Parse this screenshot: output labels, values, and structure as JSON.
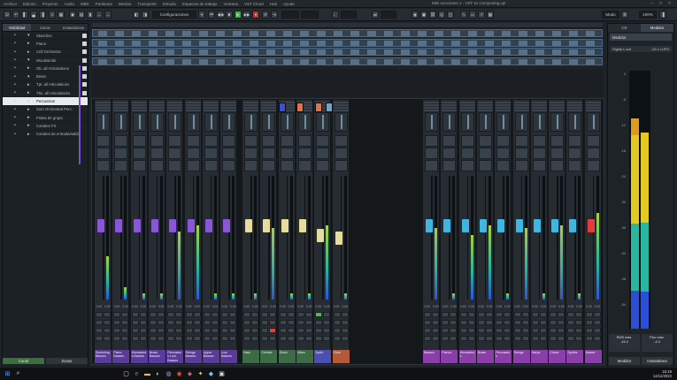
{
  "menu": [
    "Archivo",
    "Edición",
    "Proyecto",
    "Audio",
    "MIDI",
    "Partituras",
    "Medios",
    "Transporte",
    "Estudio",
    "Espacios de trabajo",
    "Ventana",
    "VST Cloud",
    "Hub",
    "Ayuda"
  ],
  "window_title": "Mini Lecciones 1 - VST 11 Composing.cpr",
  "toolbar": {
    "config_label": "Configuraciones",
    "mode_label": "Modo",
    "zoom_label": "100%"
  },
  "left_tabs": [
    "Visibilidad",
    "Zonas",
    "Instantáneas"
  ],
  "tracks": [
    {
      "name": "Sketches",
      "expanded": true
    },
    {
      "name": "Piano",
      "expanded": false
    },
    {
      "name": "Cell Orchestra",
      "expanded": false
    },
    {
      "name": "Woodwinds",
      "expanded": true
    },
    {
      "name": "Ob. all Articulations",
      "expanded": false
    },
    {
      "name": "Brass",
      "expanded": true
    },
    {
      "name": "Tpt. all Articulations",
      "expanded": false
    },
    {
      "name": "Tbn. all Articulations",
      "expanded": false
    },
    {
      "name": "Percussion",
      "expanded": true
    },
    {
      "name": "Sum Orchestral Perc.",
      "expanded": false
    },
    {
      "name": "Pistas de grupo",
      "expanded": false
    },
    {
      "name": "Canales FX",
      "expanded": false
    },
    {
      "name": "Canales de entrada/salida",
      "expanded": false
    }
  ],
  "selected_track_index": 8,
  "left_footer": [
    "Canal",
    "Zonas"
  ],
  "strips_group1": [
    {
      "name": "Sketching Basses",
      "fader": 0.6,
      "level": 0.35,
      "color": "#8a56d8",
      "label_bg": "#5b3b9a"
    },
    {
      "name": "Piano Basses",
      "fader": 0.6,
      "level": 0.1,
      "color": "#8a56d8",
      "label_bg": "#5b3b9a"
    },
    {
      "name": "Woodwinds Basses",
      "fader": 0.6,
      "level": 0.05,
      "color": "#8a56d8",
      "label_bg": "#5b3b9a"
    },
    {
      "name": "Brass Basses",
      "fader": 0.6,
      "level": 0.05,
      "color": "#8a56d8",
      "label_bg": "#5b3b9a"
    },
    {
      "name": "Percussion Low Basses",
      "fader": 0.6,
      "level": 0.55,
      "color": "#8a56d8",
      "label_bg": "#5b3b9a"
    },
    {
      "name": "Strings Basses",
      "fader": 0.6,
      "level": 0.6,
      "color": "#8a56d8",
      "label_bg": "#5b3b9a"
    },
    {
      "name": "Upper Basses",
      "fader": 0.6,
      "level": 0.05,
      "color": "#8a56d8",
      "label_bg": "#5b3b9a"
    },
    {
      "name": "Low Basses",
      "fader": 0.6,
      "level": 0.05,
      "color": "#8a56d8",
      "label_bg": "#5b3b9a"
    }
  ],
  "strips_group2": [
    {
      "name": "Harp",
      "fader": 0.6,
      "level": 0.05,
      "color": "#e6dca0",
      "label_bg": "#3d6b45"
    },
    {
      "name": "Celeste",
      "fader": 0.6,
      "level": 0.58,
      "color": "#e6dca0",
      "label_bg": "#3d6b45"
    },
    {
      "name": "Glock",
      "fader": 0.6,
      "level": 0.05,
      "color": "#e6dca0",
      "label_bg": "#3d6b45"
    },
    {
      "name": "Vibes",
      "fader": 0.6,
      "level": 0.05,
      "color": "#e6dca0",
      "label_bg": "#3d6b45"
    },
    {
      "name": "Synth",
      "fader": 0.52,
      "level": 0.6,
      "color": "#e6dca0",
      "label_bg": "#4b4fb0"
    },
    {
      "name": "Choir",
      "fader": 0.5,
      "level": 0.05,
      "color": "#e6dca0",
      "label_bg": "#b45a3a"
    },
    {
      "name": "Solo",
      "fader": 0.55,
      "level": 0.05,
      "color": "#e6dca0",
      "label_bg": "#3d6b45"
    },
    {
      "name": "FX",
      "fader": 0.6,
      "level": 0.6,
      "color": "#e6dca0",
      "label_bg": "#3d6b45"
    }
  ],
  "strips_group3": [
    {
      "name": "Basses",
      "fader": 0.6,
      "level": 0.58,
      "color": "#3fb6e0",
      "label_bg": "#8a3fa8"
    },
    {
      "name": "Pianos",
      "fader": 0.6,
      "level": 0.05,
      "color": "#3fb6e0",
      "label_bg": "#8a3fa8"
    },
    {
      "name": "Woodwinds",
      "fader": 0.6,
      "level": 0.52,
      "color": "#3fb6e0",
      "label_bg": "#8a3fa8"
    },
    {
      "name": "Brass",
      "fader": 0.6,
      "level": 0.6,
      "color": "#3fb6e0",
      "label_bg": "#8a3fa8"
    },
    {
      "name": "Percussion",
      "fader": 0.6,
      "level": 0.05,
      "color": "#3fb6e0",
      "label_bg": "#8a3fa8"
    },
    {
      "name": "Strings",
      "fader": 0.6,
      "level": 0.58,
      "color": "#3fb6e0",
      "label_bg": "#8a3fa8"
    },
    {
      "name": "Harps",
      "fader": 0.6,
      "level": 0.05,
      "color": "#3fb6e0",
      "label_bg": "#8a3fa8"
    },
    {
      "name": "Choirs",
      "fader": 0.6,
      "level": 0.6,
      "color": "#3fb6e0",
      "label_bg": "#8a3fa8"
    },
    {
      "name": "Synths",
      "fader": 0.6,
      "level": 0.05,
      "color": "#3fb6e0",
      "label_bg": "#8a3fa8"
    },
    {
      "name": "Master",
      "fader": 0.6,
      "level": 0.7,
      "color": "#e23c3c",
      "label_bg": "#8a3fa8"
    }
  ],
  "fader_value": "0.00",
  "right_tabs": [
    "CR",
    "Medidor"
  ],
  "right_panel": {
    "header": "Medidor",
    "sub_label": "Digital Loud",
    "sub_value": "-23.0 LUFS",
    "scale": [
      "0",
      "-6",
      "-12",
      "-18",
      "-24",
      "-30",
      "-36",
      "-42",
      "-48",
      "-54"
    ]
  },
  "loudness_bottom": [
    {
      "label": "RMS máx.",
      "value": "-15.2"
    },
    {
      "label": "Pico máx.",
      "value": "-4.3"
    }
  ],
  "right_footer": [
    "Medidor",
    "Instantánea"
  ],
  "clock": {
    "time": "15:19",
    "date": "14/11/2022"
  },
  "colors": {
    "purple": "#8a56d8",
    "yellow": "#e6dca0",
    "cyan": "#3fb6e0",
    "red": "#e23c3c",
    "green": "#2fbf3a"
  }
}
